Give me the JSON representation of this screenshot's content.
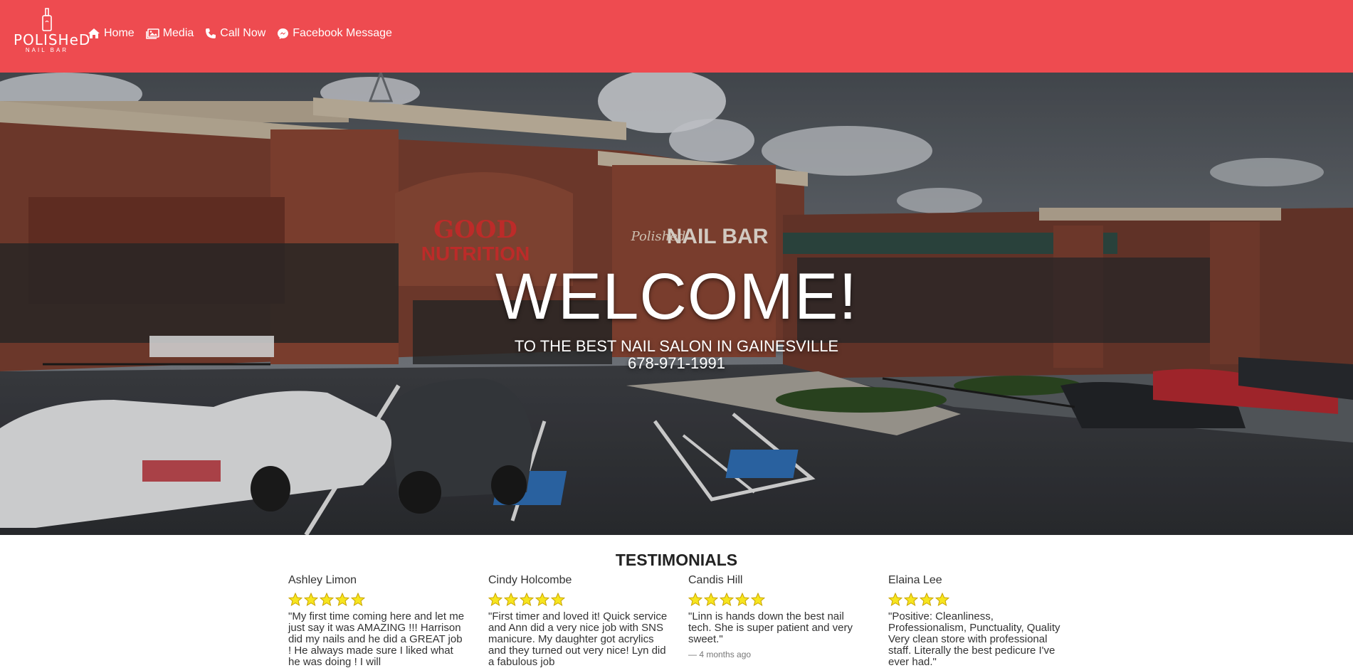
{
  "brand": {
    "logo_main": "POLISHeD",
    "logo_sub": "NAIL BAR"
  },
  "nav": [
    {
      "label": "Home",
      "icon": "home-icon"
    },
    {
      "label": "Media",
      "icon": "images-icon"
    },
    {
      "label": "Call Now",
      "icon": "phone-icon"
    },
    {
      "label": "Facebook Message",
      "icon": "messenger-icon"
    }
  ],
  "hero": {
    "title": "WELCOME!",
    "subtitle": "TO THE BEST NAIL SALON IN GAINESVILLE",
    "phone": "678-971-1991",
    "signs": {
      "good_nutrition_1": "GOOD",
      "good_nutrition_2": "NUTRITION",
      "nail_bar_script": "Polished",
      "nail_bar": "NAIL BAR"
    }
  },
  "testimonials": {
    "title": "TESTIMONIALS",
    "reviews": [
      {
        "name": "Ashley Limon",
        "rating": 5,
        "text": "\"My first time coming here and let me just say it was AMAZING !!! Harrison did my nails and he did a GREAT job ! He always made sure I liked what he was doing ! I will",
        "time": ""
      },
      {
        "name": "Cindy Holcombe",
        "rating": 5,
        "text": "\"First timer and loved it! Quick service and Ann did a very nice job with SNS manicure. My daughter got acrylics and they turned out very nice! Lyn did a fabulous job",
        "time": ""
      },
      {
        "name": "Candis Hill",
        "rating": 5,
        "text": "\"Linn is hands down the best nail tech. She is super patient and very sweet.\"",
        "time": "— 4 months ago"
      },
      {
        "name": "Elaina Lee",
        "rating": 4,
        "text": "\"Positive: Cleanliness, Professionalism, Punctuality, Quality Very clean store with professional staff. Literally the best pedicure I've ever had.\"",
        "time": ""
      }
    ]
  },
  "colors": {
    "nav_bg": "#ee4b50",
    "star": "#f7e51e",
    "text": "#333333"
  }
}
